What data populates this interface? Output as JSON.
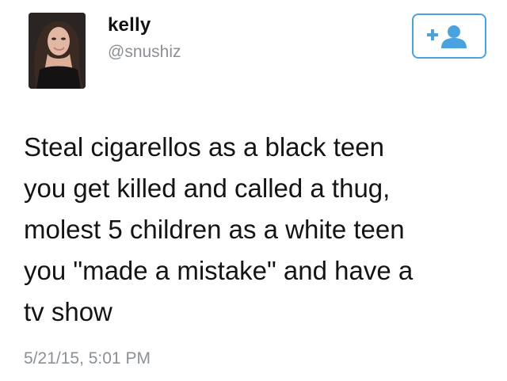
{
  "user": {
    "display_name": "kelly",
    "handle": "@snushiz",
    "avatar_icon": "profile-photo"
  },
  "follow_button": {
    "icon": "add-user-icon",
    "accent_color": "#4aa3df"
  },
  "tweet": {
    "text": "Steal cigarellos as a black teen\nyou get killed and called a thug,\nmolest 5 children as a white teen\nyou \"made a mistake\" and have a\ntv show",
    "timestamp": "5/21/15, 5:01 PM"
  },
  "colors": {
    "text": "#141414",
    "secondary_text": "#8a9096",
    "background": "#ffffff"
  }
}
